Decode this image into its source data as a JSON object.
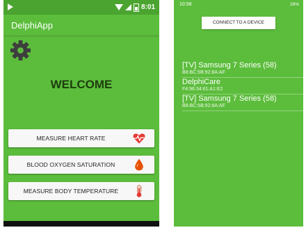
{
  "left_screen": {
    "status_bar": {
      "time": "8:01"
    },
    "app_bar": {
      "title": "DelphiApp"
    },
    "welcome_text": "WELCOME",
    "buttons": [
      {
        "label": "MEASURE HEART RATE",
        "icon": "heart-rate-icon"
      },
      {
        "label": "BLOOD OXYGEN SATURATION",
        "icon": "blood-drop-icon"
      },
      {
        "label": "MEASURE BODY TEMPERATURE",
        "icon": "thermometer-icon"
      }
    ]
  },
  "right_screen": {
    "status_bar": {
      "time": "10:58",
      "battery": "28%"
    },
    "connect_button": "CONNECT TO A DEVICE",
    "devices": [
      {
        "name": "[TV] Samsung 7 Series (58)",
        "address": "B8:BC:5B:92:8A:AF"
      },
      {
        "name": "DelphiCare",
        "address": "F4:96:34:61:A1:E2"
      },
      {
        "name": "[TV] Samsung 7 Series (58)",
        "address": "B8:BC:5B:92:8A:AF"
      }
    ]
  },
  "colors": {
    "app_green": "#5cbd3c",
    "status_green": "#4aa42f",
    "heart_red": "#e53935",
    "drop_orange": "#e65100"
  }
}
